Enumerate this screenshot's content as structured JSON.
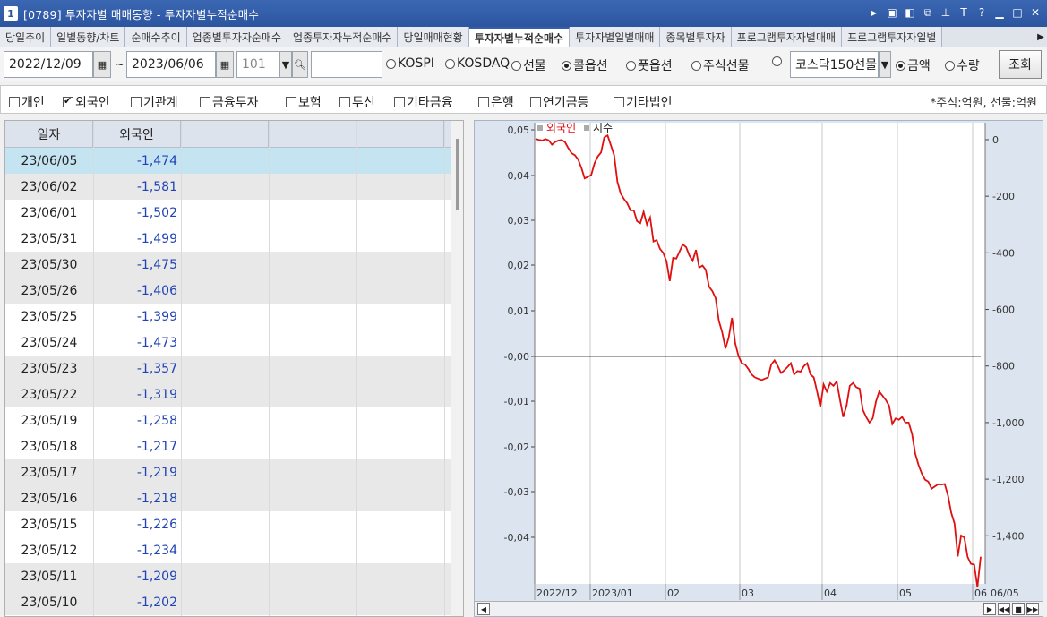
{
  "window": {
    "number": "1",
    "title": "[0789] 투자자별 매매동향 - 투자자별누적순매수"
  },
  "tabs": [
    {
      "label": "당일추이",
      "active": false
    },
    {
      "label": "일별동향/차트",
      "active": false
    },
    {
      "label": "순매수추이",
      "active": false
    },
    {
      "label": "업종별투자자순매수",
      "active": false
    },
    {
      "label": "업종투자자누적순매수",
      "active": false
    },
    {
      "label": "당일매매현황",
      "active": false
    },
    {
      "label": "투자자별누적순매수",
      "active": true
    },
    {
      "label": "투자자별일별매매",
      "active": false
    },
    {
      "label": "종목별투자자",
      "active": false
    },
    {
      "label": "프로그램투자자별매매",
      "active": false
    },
    {
      "label": "프로그램투자자일별",
      "active": false
    }
  ],
  "toolbar": {
    "date_from": "2022/12/09",
    "tilde": "~",
    "date_to": "2023/06/06",
    "code": "101",
    "code_name": "",
    "markets": [
      {
        "label": "KOSPI",
        "checked": false
      },
      {
        "label": "KOSDAQ",
        "checked": false
      },
      {
        "label": "선물",
        "checked": false
      },
      {
        "label": "콜옵션",
        "checked": true
      },
      {
        "label": "풋옵션",
        "checked": false
      },
      {
        "label": "주식선물",
        "checked": false
      },
      {
        "label": "",
        "checked": false
      }
    ],
    "product": "코스닥150선물",
    "measures": [
      {
        "label": "금액",
        "checked": true
      },
      {
        "label": "수량",
        "checked": false
      }
    ],
    "query_label": "조회"
  },
  "filters": [
    {
      "label": "개인",
      "checked": false
    },
    {
      "label": "외국인",
      "checked": true
    },
    {
      "label": "기관계",
      "checked": false
    },
    {
      "label": "금융투자",
      "checked": false
    },
    {
      "label": "보험",
      "checked": false
    },
    {
      "label": "투신",
      "checked": false
    },
    {
      "label": "기타금융",
      "checked": false
    },
    {
      "label": "은행",
      "checked": false
    },
    {
      "label": "연기금등",
      "checked": false
    },
    {
      "label": "기타법인",
      "checked": false
    }
  ],
  "unit_note": "*주식:억원, 선물:억원",
  "grid": {
    "headers": [
      "일자",
      "외국인"
    ],
    "rows": [
      {
        "date": "23/06/05",
        "value": "-1,474"
      },
      {
        "date": "23/06/02",
        "value": "-1,581"
      },
      {
        "date": "23/06/01",
        "value": "-1,502"
      },
      {
        "date": "23/05/31",
        "value": "-1,499"
      },
      {
        "date": "23/05/30",
        "value": "-1,475"
      },
      {
        "date": "23/05/26",
        "value": "-1,406"
      },
      {
        "date": "23/05/25",
        "value": "-1,399"
      },
      {
        "date": "23/05/24",
        "value": "-1,473"
      },
      {
        "date": "23/05/23",
        "value": "-1,357"
      },
      {
        "date": "23/05/22",
        "value": "-1,319"
      },
      {
        "date": "23/05/19",
        "value": "-1,258"
      },
      {
        "date": "23/05/18",
        "value": "-1,217"
      },
      {
        "date": "23/05/17",
        "value": "-1,219"
      },
      {
        "date": "23/05/16",
        "value": "-1,218"
      },
      {
        "date": "23/05/15",
        "value": "-1,226"
      },
      {
        "date": "23/05/12",
        "value": "-1,234"
      },
      {
        "date": "23/05/11",
        "value": "-1,209"
      },
      {
        "date": "23/05/10",
        "value": "-1,202"
      }
    ]
  },
  "chart_data": {
    "type": "line",
    "legend": [
      {
        "name": "외국인",
        "color": "#e01010"
      },
      {
        "name": "지수",
        "color": "#222222"
      }
    ],
    "left_axis": {
      "ticks": [
        "0,05",
        "0,04",
        "0,03",
        "0,02",
        "0,01",
        "-0,00",
        "-0,01",
        "-0,02",
        "-0,03",
        "-0,04"
      ],
      "range": [
        -0.05,
        0.05
      ]
    },
    "right_axis": {
      "ticks": [
        "0",
        "-200",
        "-400",
        "-600",
        "-800",
        "-1,000",
        "-1,200",
        "-1,400"
      ],
      "range": [
        -1570,
        60
      ]
    },
    "x_labels": [
      "2022/12",
      "2023/01",
      "02",
      "03",
      "04",
      "05",
      "06"
    ],
    "x_end_label": "06/05",
    "index_value": 0.0,
    "series": [
      {
        "name": "외국인",
        "color": "#e01010",
        "values": [
          3,
          -1,
          -3,
          2,
          -2,
          -18,
          -8,
          -3,
          -1,
          -9,
          -30,
          -48,
          -55,
          -70,
          -100,
          -137,
          -131,
          -125,
          -84,
          -60,
          -45,
          8,
          15,
          -20,
          -55,
          -150,
          -190,
          -210,
          -225,
          -250,
          -250,
          -288,
          -295,
          -255,
          -300,
          -275,
          -360,
          -355,
          -386,
          -400,
          -430,
          -500,
          -418,
          -420,
          -395,
          -370,
          -380,
          -410,
          -428,
          -390,
          -452,
          -445,
          -460,
          -520,
          -535,
          -560,
          -640,
          -680,
          -738,
          -700,
          -630,
          -720,
          -765,
          -790,
          -795,
          -810,
          -830,
          -840,
          -845,
          -850,
          -845,
          -840,
          -795,
          -780,
          -800,
          -825,
          -815,
          -803,
          -790,
          -830,
          -818,
          -820,
          -800,
          -790,
          -830,
          -840,
          -890,
          -945,
          -865,
          -890,
          -860,
          -870,
          -855,
          -920,
          -980,
          -940,
          -870,
          -860,
          -875,
          -880,
          -955,
          -980,
          -1000,
          -985,
          -925,
          -890,
          -905,
          -920,
          -940,
          -1005,
          -985,
          -990,
          -980,
          -1000,
          -1000,
          -1040,
          -1110,
          -1150,
          -1180,
          -1202,
          -1209,
          -1234,
          -1226,
          -1218,
          -1219,
          -1217,
          -1258,
          -1319,
          -1357,
          -1473,
          -1399,
          -1406,
          -1475,
          -1499,
          -1502,
          -1581,
          -1474
        ]
      }
    ]
  }
}
